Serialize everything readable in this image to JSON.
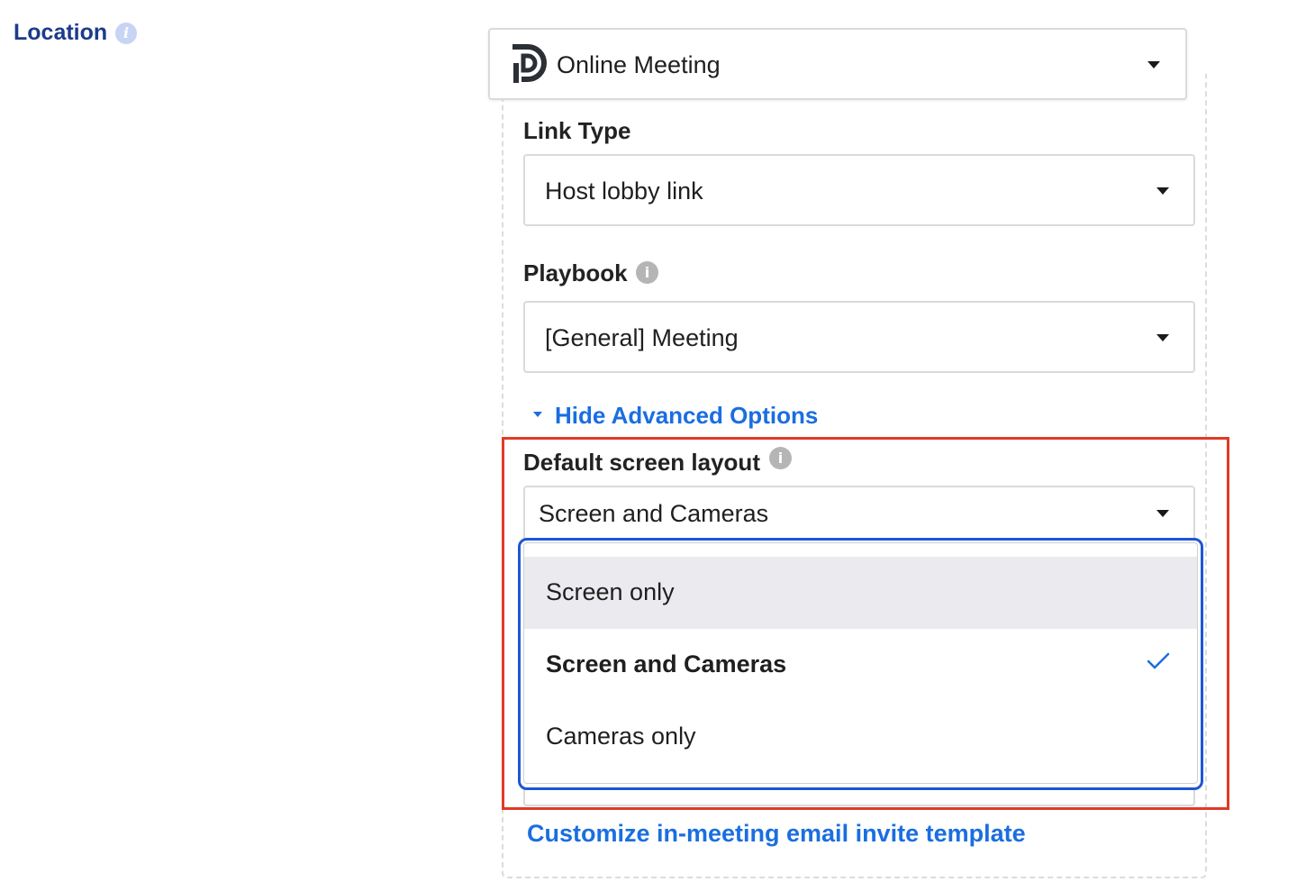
{
  "location": {
    "label": "Location",
    "info_icon": "info-icon",
    "selected_value": "Online Meeting",
    "logo_icon": "meeting-provider-logo-icon"
  },
  "link_type": {
    "label": "Link Type",
    "value": "Host lobby link"
  },
  "playbook": {
    "label": "Playbook",
    "info_icon": "info-icon",
    "value": "[General] Meeting"
  },
  "advanced": {
    "toggle_label": "Hide Advanced Options",
    "toggle_icon": "caret-down-icon"
  },
  "default_screen_layout": {
    "label": "Default screen layout",
    "info_icon": "info-icon",
    "value": "Screen and Cameras",
    "options": [
      {
        "label": "Screen only",
        "state": "hovered"
      },
      {
        "label": "Screen and Cameras",
        "state": "selected"
      },
      {
        "label": "Cameras only",
        "state": "normal"
      }
    ],
    "check_icon": "check-icon"
  },
  "customize_link": "Customize in-meeting email invite template",
  "colors": {
    "link_blue": "#1a6ee0",
    "location_label": "#1d3a8c",
    "highlight_red": "#e03a26",
    "focus_blue": "#1e56d6",
    "hover_grey": "#ebebef"
  }
}
